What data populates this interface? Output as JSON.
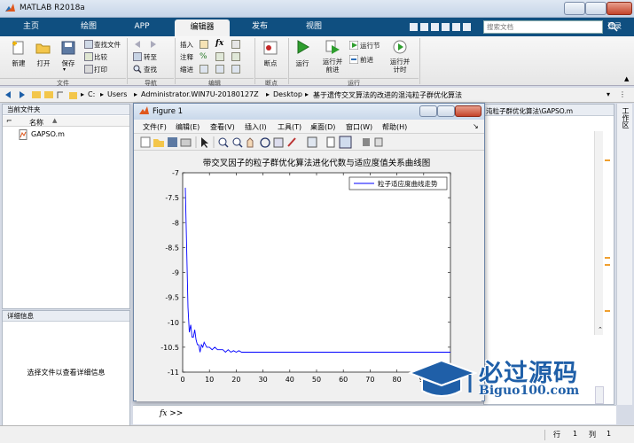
{
  "app": {
    "title": "MATLAB R2018a"
  },
  "tabs": [
    {
      "label": "主页"
    },
    {
      "label": "绘图"
    },
    {
      "label": "APP"
    },
    {
      "label": "编辑器"
    },
    {
      "label": "发布"
    },
    {
      "label": "视图"
    }
  ],
  "search": {
    "placeholder": "搜索文档"
  },
  "login": "登录",
  "ribbon": {
    "file": {
      "new": "新建",
      "open": "打开",
      "save": "保存",
      "find_files": "查找文件",
      "compare": "比较",
      "print": "打印",
      "group": "文件"
    },
    "nav": {
      "goto": "转至",
      "find": "查找",
      "group": "导航"
    },
    "edit": {
      "insert": "插入",
      "comment": "注释",
      "indent": "缩进",
      "fx": "fx",
      "group": "编辑"
    },
    "breakpoints": {
      "label": "断点",
      "group": "断点"
    },
    "run": {
      "run": "运行",
      "run_advance": "运行并\n前进",
      "run_section": "运行节",
      "advance": "前进",
      "run_time": "运行并\n计时",
      "group": "运行"
    }
  },
  "path": {
    "segments": [
      "C:",
      "Users",
      "Administrator.WIN7U-20180127Z",
      "Desktop",
      "基于遗传交叉算法的改进的混沌粒子群优化算法"
    ]
  },
  "current_folder": {
    "title": "当前文件夹",
    "column": "名称",
    "files": [
      {
        "name": "GAPSO.m"
      }
    ]
  },
  "details": {
    "title": "详细信息",
    "message": "选择文件以查看详细信息"
  },
  "editor_tab": {
    "label": "沌粒子群优化算法\\GAPSO.m"
  },
  "workspace_label": "工作区",
  "figure": {
    "title": "Figure 1",
    "menu": [
      "文件(F)",
      "编辑(E)",
      "查看(V)",
      "插入(I)",
      "工具(T)",
      "桌面(D)",
      "窗口(W)",
      "帮助(H)"
    ]
  },
  "chart_data": {
    "type": "line",
    "title": "带交叉因子的粒子群优化算法进化代数与适应度值关系曲线图",
    "xlabel": "",
    "ylabel": "",
    "xlim": [
      0,
      100
    ],
    "ylim": [
      -11,
      -7
    ],
    "xticks": [
      0,
      10,
      20,
      30,
      40,
      50,
      60,
      70,
      80,
      90,
      100
    ],
    "yticks": [
      -7,
      -7.5,
      -8,
      -8.5,
      -9,
      -9.5,
      -10,
      -10.5,
      -11
    ],
    "xtick_labels": [
      "0",
      "10",
      "20",
      "30",
      "40",
      "50",
      "60",
      "70",
      "80",
      "90",
      "100"
    ],
    "ytick_labels": [
      "-7",
      "-7.5",
      "-8",
      "-8.5",
      "-9",
      "-9.5",
      "-10",
      "-10.5",
      "-11"
    ],
    "grid": false,
    "legend": "top-right",
    "series": [
      {
        "name": "粒子适应度曲线走势",
        "color": "#0000ff",
        "x": [
          1,
          2,
          2.5,
          3,
          3.5,
          4,
          4.5,
          5,
          5.5,
          6,
          6.5,
          7,
          7.5,
          8,
          9,
          10,
          11,
          12,
          13,
          14,
          15,
          16,
          17,
          18,
          19,
          20,
          21,
          22,
          23,
          25,
          30,
          40,
          50,
          60,
          70,
          80,
          90,
          100
        ],
        "y": [
          -7.3,
          -9.7,
          -10.2,
          -10.05,
          -10.3,
          -10.3,
          -10.15,
          -10.35,
          -10.45,
          -10.45,
          -10.6,
          -10.45,
          -10.5,
          -10.4,
          -10.5,
          -10.5,
          -10.55,
          -10.5,
          -10.55,
          -10.55,
          -10.55,
          -10.6,
          -10.55,
          -10.6,
          -10.57,
          -10.6,
          -10.57,
          -10.6,
          -10.6,
          -10.6,
          -10.6,
          -10.6,
          -10.6,
          -10.6,
          -10.6,
          -10.6,
          -10.6,
          -10.6
        ]
      }
    ]
  },
  "command": {
    "prompt": "fx >>"
  },
  "status": {
    "row_label": "行",
    "row": "1",
    "col_label": "列",
    "col": "1"
  },
  "watermark": {
    "brand": "必过源码",
    "domain": "Biguo100.com"
  },
  "colors": {
    "tab_bg": "#0f4f80",
    "accent": "#1f5fa8"
  }
}
